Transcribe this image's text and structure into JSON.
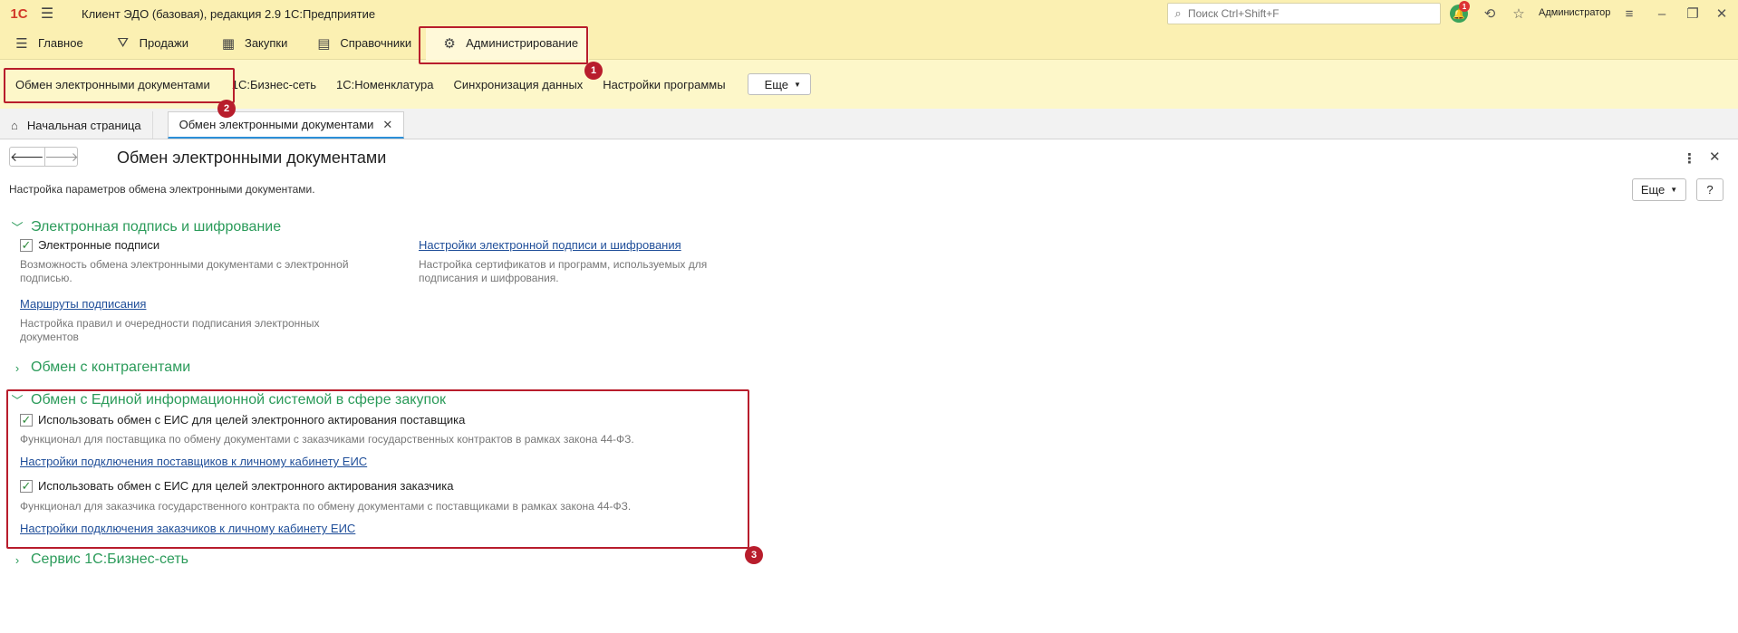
{
  "titlebar": {
    "logo": "1С",
    "app_title": "Клиент ЭДО (базовая), редакция 2.9 1С:Предприятие",
    "search_placeholder": "Поиск Ctrl+Shift+F",
    "notification_count": "1",
    "user_name": "Администратор"
  },
  "sections": [
    {
      "label": "Главное",
      "icon": "menu-icon"
    },
    {
      "label": "Продажи",
      "icon": "basket-icon"
    },
    {
      "label": "Закупки",
      "icon": "warehouse-icon"
    },
    {
      "label": "Справочники",
      "icon": "directory-icon"
    },
    {
      "label": "Администрирование",
      "icon": "gear-icon"
    }
  ],
  "functions": {
    "items": [
      "Обмен электронными документами",
      "1С:Бизнес-сеть",
      "1С:Номенклатура",
      "Синхронизация данных",
      "Настройки программы"
    ],
    "more_label": "Еще"
  },
  "tabs": [
    {
      "label": "Начальная страница"
    },
    {
      "label": "Обмен электронными документами"
    }
  ],
  "page": {
    "title": "Обмен электронными документами",
    "description": "Настройка параметров обмена электронными документами.",
    "more_label": "Еще",
    "help_label": "?"
  },
  "groups": {
    "signature": {
      "title": "Электронная подпись и шифрование",
      "checkbox_label": "Электронные подписи",
      "checkbox_hint": "Возможность обмена электронными документами с электронной подписью.",
      "routes_link": "Маршруты подписания",
      "routes_hint": "Настройка правил и очередности подписания электронных документов",
      "settings_link": "Настройки электронной подписи и шифрования",
      "settings_hint": "Настройка сертификатов и программ, используемых для подписания и шифрования."
    },
    "counterparties": {
      "title": "Обмен с контрагентами"
    },
    "eis": {
      "title": "Обмен с Единой информационной системой в сфере закупок",
      "supplier_checkbox": "Использовать обмен с ЕИС для целей электронного актирования поставщика",
      "supplier_hint": "Функционал для поставщика по обмену документами с заказчиками государственных контрактов в рамках закона 44-ФЗ.",
      "supplier_link": "Настройки подключения поставщиков к личному кабинету ЕИС",
      "customer_checkbox": "Использовать обмен с ЕИС для целей электронного актирования заказчика",
      "customer_hint": "Функционал для заказчика государственного контракта по обмену документами с поставщиками в рамках закона 44-ФЗ.",
      "customer_link": "Настройки подключения заказчиков к личному кабинету ЕИС"
    },
    "business_network": {
      "title": "Сервис 1С:Бизнес-сеть"
    }
  },
  "annotations": [
    "1",
    "2",
    "3"
  ],
  "colors": {
    "panel_yellow": "#fbf0b2",
    "group_green": "#2b9b5a",
    "link_blue": "#1f4e99",
    "annotation_red": "#b81d2c"
  }
}
